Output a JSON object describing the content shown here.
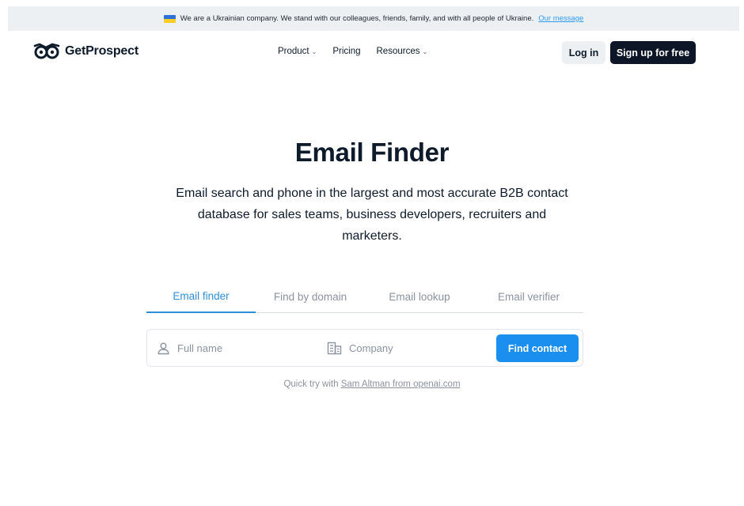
{
  "banner": {
    "text": "We are a Ukrainian company. We stand with our colleagues, friends, family, and with all people of Ukraine.",
    "link": "Our message",
    "flag_colors": [
      "#2f6fd8",
      "#f7cd2a"
    ]
  },
  "header": {
    "brand": "GetProspect",
    "nav": [
      {
        "label": "Product",
        "icon": "chevron-down-icon"
      },
      {
        "label": "Pricing"
      },
      {
        "label": "Resources",
        "icon": "chevron-down-icon"
      }
    ],
    "login_label": "Log in",
    "signup_label": "Sign up for free"
  },
  "hero": {
    "title": "Email Finder",
    "subtitle": "Email search and phone in the largest and most accurate B2B contact database for sales teams, business developers, recruiters and marketers."
  },
  "tabs": [
    {
      "label": "Email finder",
      "active": true
    },
    {
      "label": "Find by domain",
      "active": false
    },
    {
      "label": "Email lookup",
      "active": false
    },
    {
      "label": "Email verifier",
      "active": false
    }
  ],
  "search": {
    "fullname_placeholder": "Full name",
    "fullname_icon": "user-icon",
    "company_placeholder": "Company",
    "company_icon": "building-icon",
    "button_label": "Find contact"
  },
  "quick_try": {
    "prefix": "Quick try with",
    "link": "Sam Altman from openai.com"
  },
  "colors": {
    "accent": "#1b8ff0",
    "active_tab": "#2d8fd6",
    "dark_button": "#0d1626",
    "banner_bg": "#edf0f3"
  }
}
